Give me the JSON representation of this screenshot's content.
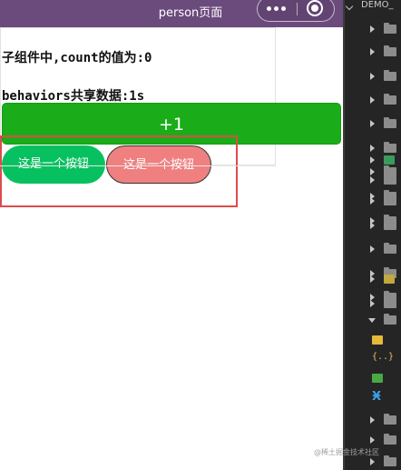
{
  "nav": {
    "title": "person页面"
  },
  "content": {
    "count_line": "子组件中,count的值为:0",
    "behaviors_line": "behaviors共享数据:1s",
    "plus_button_label": "+1",
    "button_green_label": "这是一个按钮",
    "button_red_label": "这是一个按钮"
  },
  "explorer": {
    "title": "DEMO_",
    "items": [
      {
        "type": "folder"
      },
      {
        "type": "folder"
      },
      {
        "type": "folder"
      },
      {
        "type": "folder"
      },
      {
        "type": "folder"
      },
      {
        "type": "folder"
      },
      {
        "type": "folder"
      },
      {
        "type": "folder"
      },
      {
        "type": "folder"
      },
      {
        "type": "file-green"
      },
      {
        "type": "folder"
      },
      {
        "type": "folder"
      },
      {
        "type": "folder"
      },
      {
        "type": "folder"
      },
      {
        "type": "folder"
      },
      {
        "type": "folder"
      },
      {
        "type": "file-yellow"
      },
      {
        "type": "folder"
      },
      {
        "type": "folder-open"
      },
      {
        "type": "js"
      },
      {
        "type": "json"
      },
      {
        "type": "wxml"
      },
      {
        "type": "wxss"
      },
      {
        "type": "folder"
      },
      {
        "type": "folder"
      },
      {
        "type": "folder"
      }
    ]
  },
  "watermark": "@稀土掘金技术社区",
  "colors": {
    "navbar": "#6b4a7c",
    "primary_green": "#1aad19",
    "pill_green": "#07c160",
    "pill_red": "#f08080",
    "highlight_frame": "#dd4b4b",
    "explorer_bg": "#252526"
  }
}
